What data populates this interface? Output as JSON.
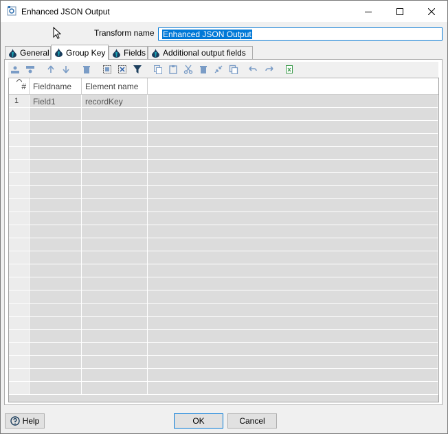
{
  "window": {
    "title": "Enhanced JSON Output"
  },
  "form": {
    "transform_name_label": "Transform name",
    "transform_name_value": "Enhanced JSON Output"
  },
  "tabs": [
    {
      "label": "General"
    },
    {
      "label": "Group Key",
      "active": true
    },
    {
      "label": "Fields"
    },
    {
      "label": "Additional output fields"
    }
  ],
  "toolbar_icons": [
    "insert-row-icon",
    "delete-row-icon",
    "move-up-icon",
    "move-down-icon",
    "delete-icon",
    "select-all-icon",
    "clear-selection-icon",
    "filter-icon",
    "copy-icon",
    "paste-icon",
    "cut-icon",
    "delete-selected-icon",
    "shrink-icon",
    "copy-rows-icon",
    "undo-icon",
    "redo-icon",
    "export-icon"
  ],
  "table": {
    "columns": [
      "#",
      "Fieldname",
      "Element name"
    ],
    "rows": [
      {
        "num": "1",
        "fieldname": "Field1",
        "element_name": "recordKey"
      }
    ]
  },
  "buttons": {
    "help": "Help",
    "ok": "OK",
    "cancel": "Cancel"
  },
  "colors": {
    "selection": "#0078d7",
    "grid_bg": "#dcdcdc"
  }
}
